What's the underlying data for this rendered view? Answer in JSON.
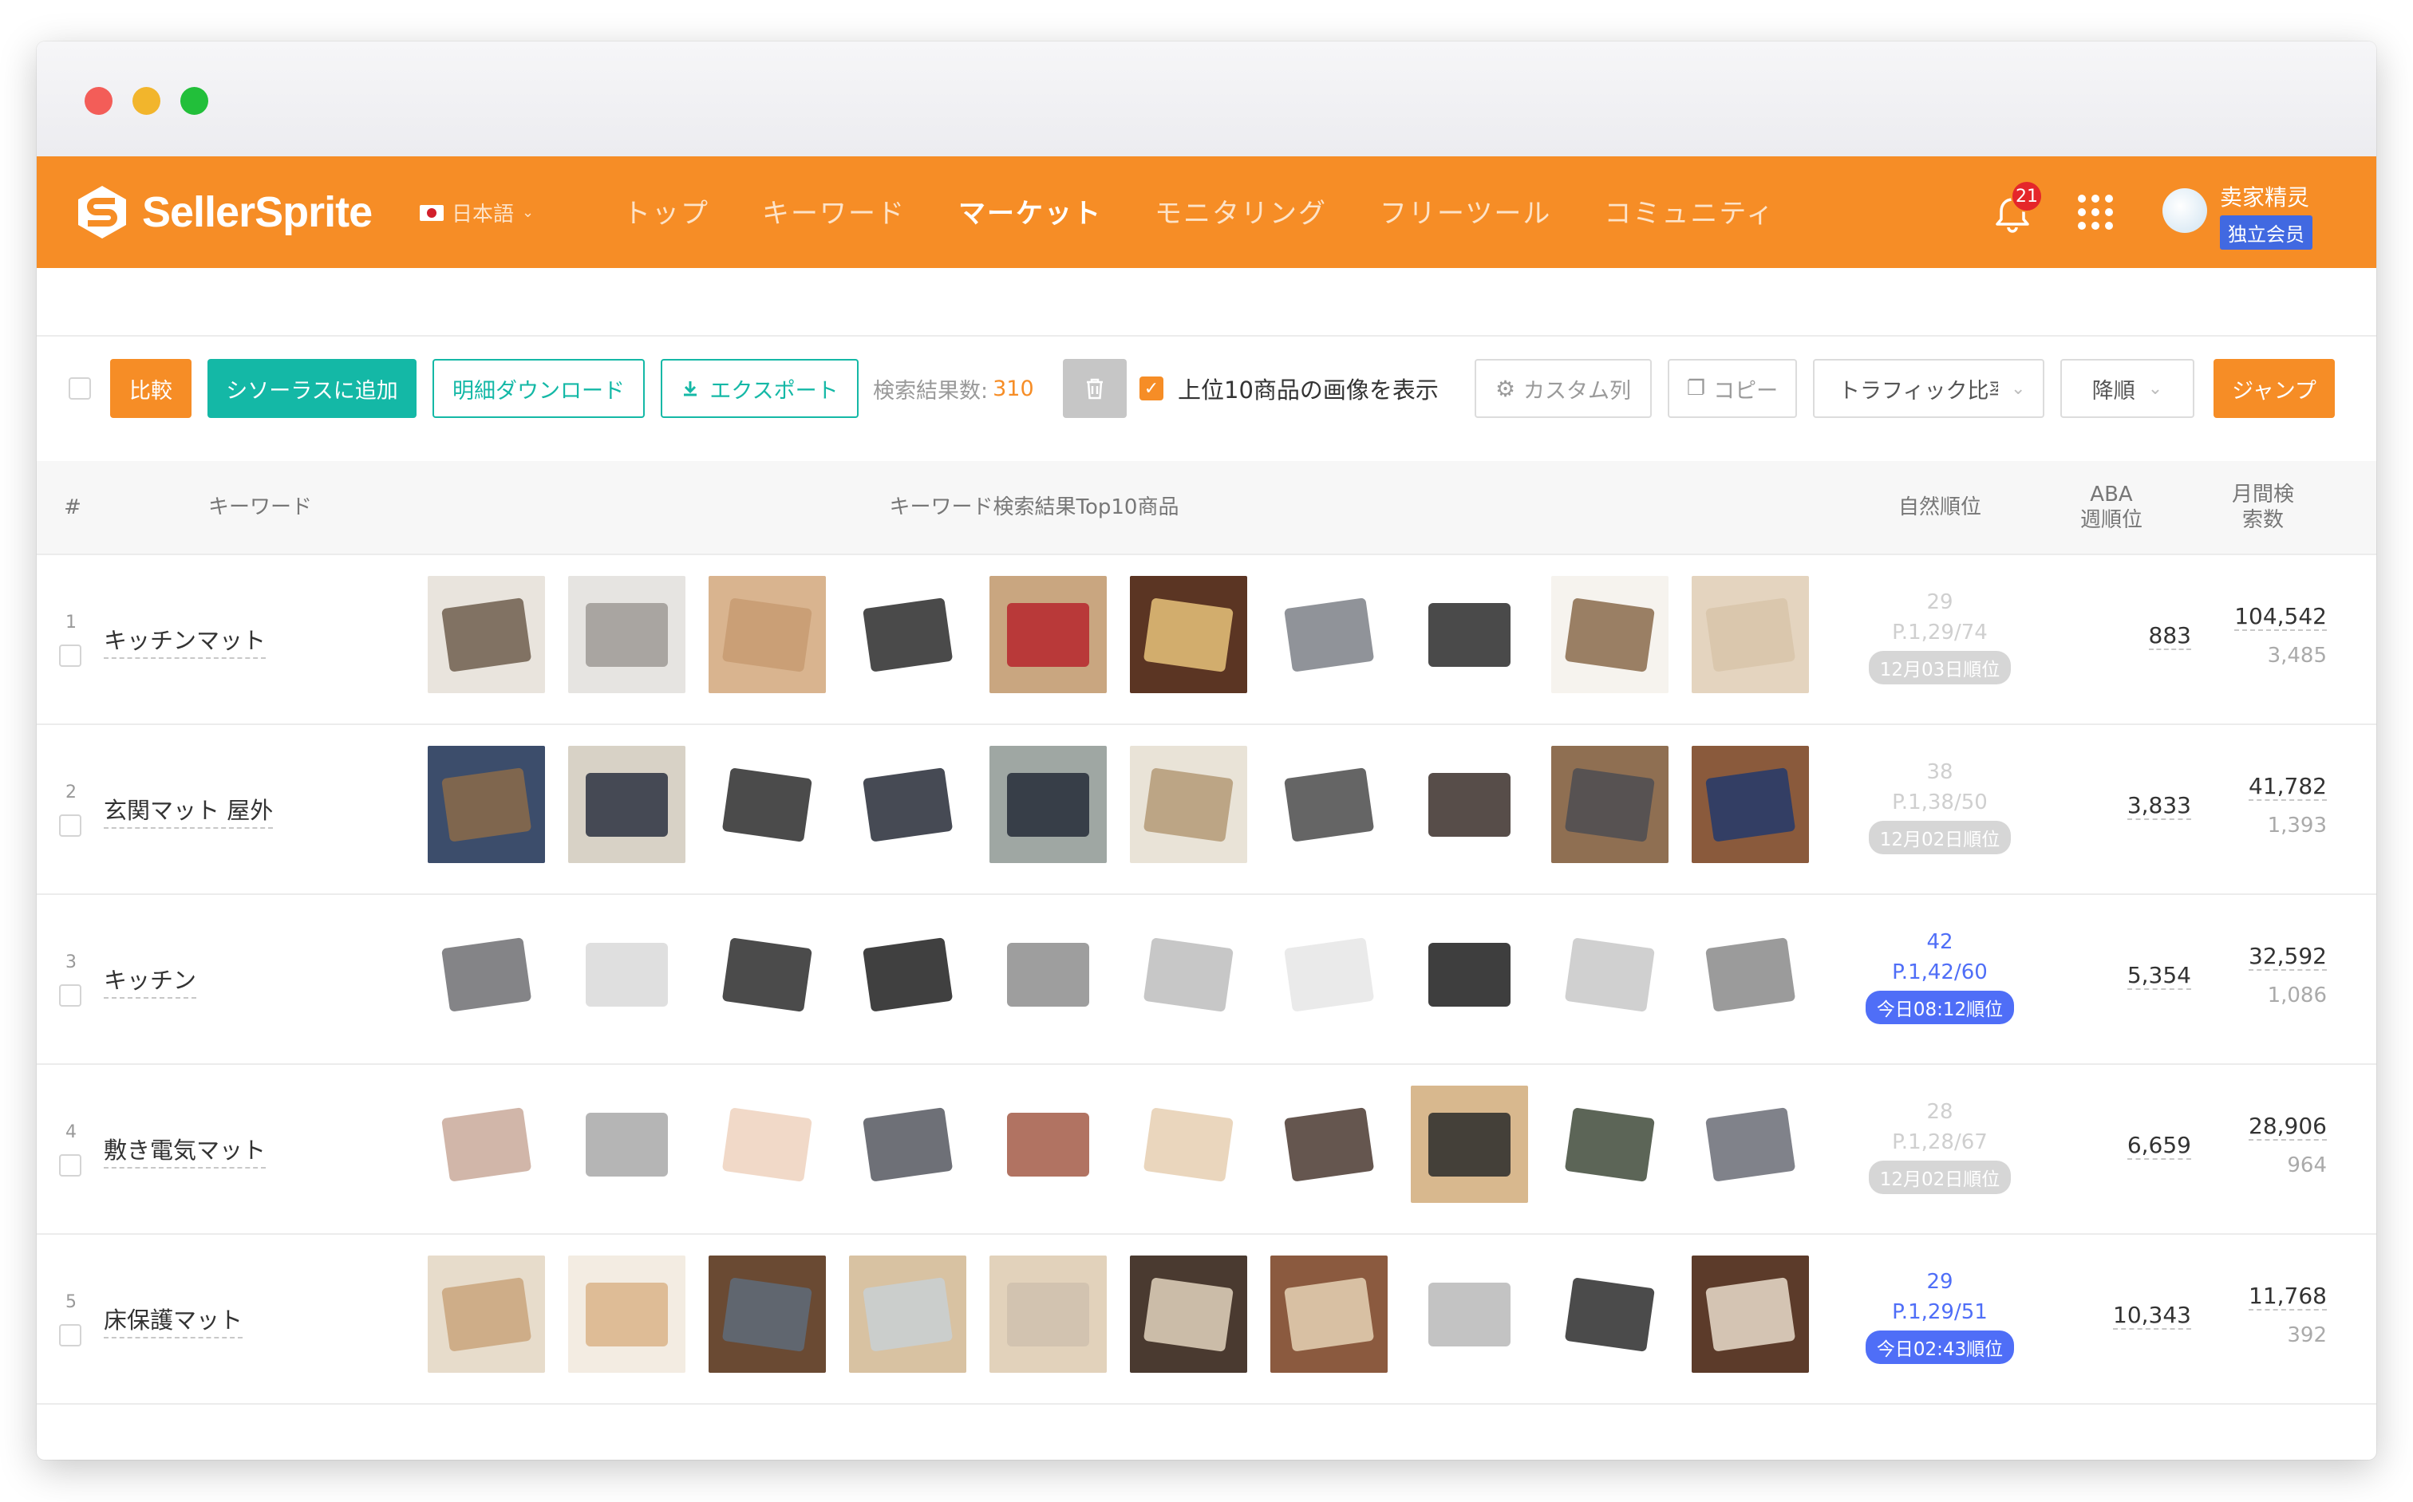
{
  "window": {},
  "nav": {
    "logo_text": "SellerSprite",
    "language": "日本語",
    "items": [
      "トップ",
      "キーワード",
      "マーケット",
      "モニタリング",
      "フリーツール",
      "コミュニティ"
    ],
    "active_index": 2,
    "notification_count": "21",
    "user_name": "卖家精灵",
    "member_badge": "独立会员"
  },
  "toolbar": {
    "compare": "比較",
    "add_thesaurus": "シソーラスに追加",
    "detail_download": "明細ダウンロード",
    "export": "エクスポート",
    "result_label": "検索結果数:",
    "result_count": "310",
    "show_images_label": "上位10商品の画像を表示",
    "custom_columns": "カスタム列",
    "copy": "コピー",
    "sort_field": "トラフィック比率",
    "sort_order": "降順",
    "jump": "ジャンプ"
  },
  "table": {
    "headers": {
      "index": "#",
      "keyword": "キーワード",
      "top10": "キーワード検索結果Top10商品",
      "organic_rank": "自然順位",
      "aba_line1": "ABA",
      "aba_line2": "週順位",
      "monthly_line1": "月間検",
      "monthly_line2": "索数"
    },
    "rows": [
      {
        "num": "1",
        "keyword": "キッチンマット",
        "rank": "29",
        "rank_page": "P.1,29/74",
        "rank_time": "12月03日順位",
        "rank_style": "gray",
        "aba": "883",
        "monthly": "104,542",
        "monthly_sub": "3,485",
        "thumbs": [
          {
            "bg": "#e9e4dd",
            "fg": "#6f5e4d"
          },
          {
            "bg": "#e6e4e1",
            "fg": "#9e9a95"
          },
          {
            "bg": "#d9b48f",
            "fg": "#c79b72"
          },
          {
            "bg": "#ffffff",
            "fg": "#2a2a2a"
          },
          {
            "bg": "#c9a680",
            "fg": "#b6262d"
          },
          {
            "bg": "#5b3523",
            "fg": "#e7c27a"
          },
          {
            "bg": "#ffffff",
            "fg": "#7d8087"
          },
          {
            "bg": "#ffffff",
            "fg": "#2a2a2a"
          },
          {
            "bg": "#f6f3ee",
            "fg": "#8a6a4b"
          },
          {
            "bg": "#e4d4bf",
            "fg": "#d8c4a9"
          }
        ]
      },
      {
        "num": "2",
        "keyword": "玄関マット 屋外",
        "rank": "38",
        "rank_page": "P.1,38/50",
        "rank_time": "12月02日順位",
        "rank_style": "gray",
        "aba": "3,833",
        "monthly": "41,782",
        "monthly_sub": "1,393",
        "thumbs": [
          {
            "bg": "#3c4d6b",
            "fg": "#8b6b49"
          },
          {
            "bg": "#d8d2c6",
            "fg": "#2c3140"
          },
          {
            "bg": "#ffffff",
            "fg": "#2b2b2b"
          },
          {
            "bg": "#ffffff",
            "fg": "#262a36"
          },
          {
            "bg": "#9fa7a3",
            "fg": "#242b38"
          },
          {
            "bg": "#e9e3d7",
            "fg": "#b49a77"
          },
          {
            "bg": "#ffffff",
            "fg": "#4a4a4a"
          },
          {
            "bg": "#ffffff",
            "fg": "#3a2e29"
          },
          {
            "bg": "#8f6f52",
            "fg": "#4d4d52"
          },
          {
            "bg": "#8a5a3c",
            "fg": "#233a6b"
          }
        ]
      },
      {
        "num": "3",
        "keyword": "キッチン",
        "rank": "42",
        "rank_page": "P.1,42/60",
        "rank_time": "今日08:12順位",
        "rank_style": "blue",
        "aba": "5,354",
        "monthly": "32,592",
        "monthly_sub": "1,086",
        "thumbs": [
          {
            "bg": "#ffffff",
            "fg": "#6f6f72"
          },
          {
            "bg": "#ffffff",
            "fg": "#d9d9d9"
          },
          {
            "bg": "#ffffff",
            "fg": "#2b2b2b"
          },
          {
            "bg": "#ffffff",
            "fg": "#1e1e1e"
          },
          {
            "bg": "#ffffff",
            "fg": "#8d8d8d"
          },
          {
            "bg": "#ffffff",
            "fg": "#bdbdbd"
          },
          {
            "bg": "#ffffff",
            "fg": "#e6e6e6"
          },
          {
            "bg": "#ffffff",
            "fg": "#1c1c1c"
          },
          {
            "bg": "#ffffff",
            "fg": "#c8c8c8"
          },
          {
            "bg": "#ffffff",
            "fg": "#8a8a8a"
          }
        ]
      },
      {
        "num": "4",
        "keyword": "敷き電気マット",
        "rank": "28",
        "rank_page": "P.1,28/67",
        "rank_time": "12月02日順位",
        "rank_style": "gray",
        "aba": "6,659",
        "monthly": "28,906",
        "monthly_sub": "964",
        "thumbs": [
          {
            "bg": "#ffffff",
            "fg": "#c9a99a"
          },
          {
            "bg": "#ffffff",
            "fg": "#a8a8a8"
          },
          {
            "bg": "#ffffff",
            "fg": "#efd2be"
          },
          {
            "bg": "#ffffff",
            "fg": "#55575f"
          },
          {
            "bg": "#ffffff",
            "fg": "#a35a47"
          },
          {
            "bg": "#ffffff",
            "fg": "#e6cfb2"
          },
          {
            "bg": "#ffffff",
            "fg": "#4a3830"
          },
          {
            "bg": "#d8b88e",
            "fg": "#2a2a2a"
          },
          {
            "bg": "#ffffff",
            "fg": "#3f4a3a"
          },
          {
            "bg": "#ffffff",
            "fg": "#6a6c75"
          }
        ]
      },
      {
        "num": "5",
        "keyword": "床保護マット",
        "rank": "29",
        "rank_page": "P.1,29/51",
        "rank_time": "今日02:43順位",
        "rank_style": "blue",
        "aba": "10,343",
        "monthly": "11,768",
        "monthly_sub": "392",
        "thumbs": [
          {
            "bg": "#e7dccb",
            "fg": "#c9a47c"
          },
          {
            "bg": "#f3ece2",
            "fg": "#d9b488"
          },
          {
            "bg": "#6a4a33",
            "fg": "#5e6b7a"
          },
          {
            "bg": "#d8c2a2",
            "fg": "#c9d0d4"
          },
          {
            "bg": "#e2d2bb",
            "fg": "#cfc1ae"
          },
          {
            "bg": "#4a3a30",
            "fg": "#e2d3bd"
          },
          {
            "bg": "#8b5a3f",
            "fg": "#e5d2b5"
          },
          {
            "bg": "#ffffff",
            "fg": "#b8b8b8"
          },
          {
            "bg": "#ffffff",
            "fg": "#2b2b2b"
          },
          {
            "bg": "#5c3b2a",
            "fg": "#e9ddcb"
          }
        ]
      }
    ]
  },
  "colors": {
    "brand_orange": "#f68d26",
    "teal": "#14b8a6",
    "rank_blue": "#4f6ef7",
    "badge_red": "#e5262a"
  }
}
